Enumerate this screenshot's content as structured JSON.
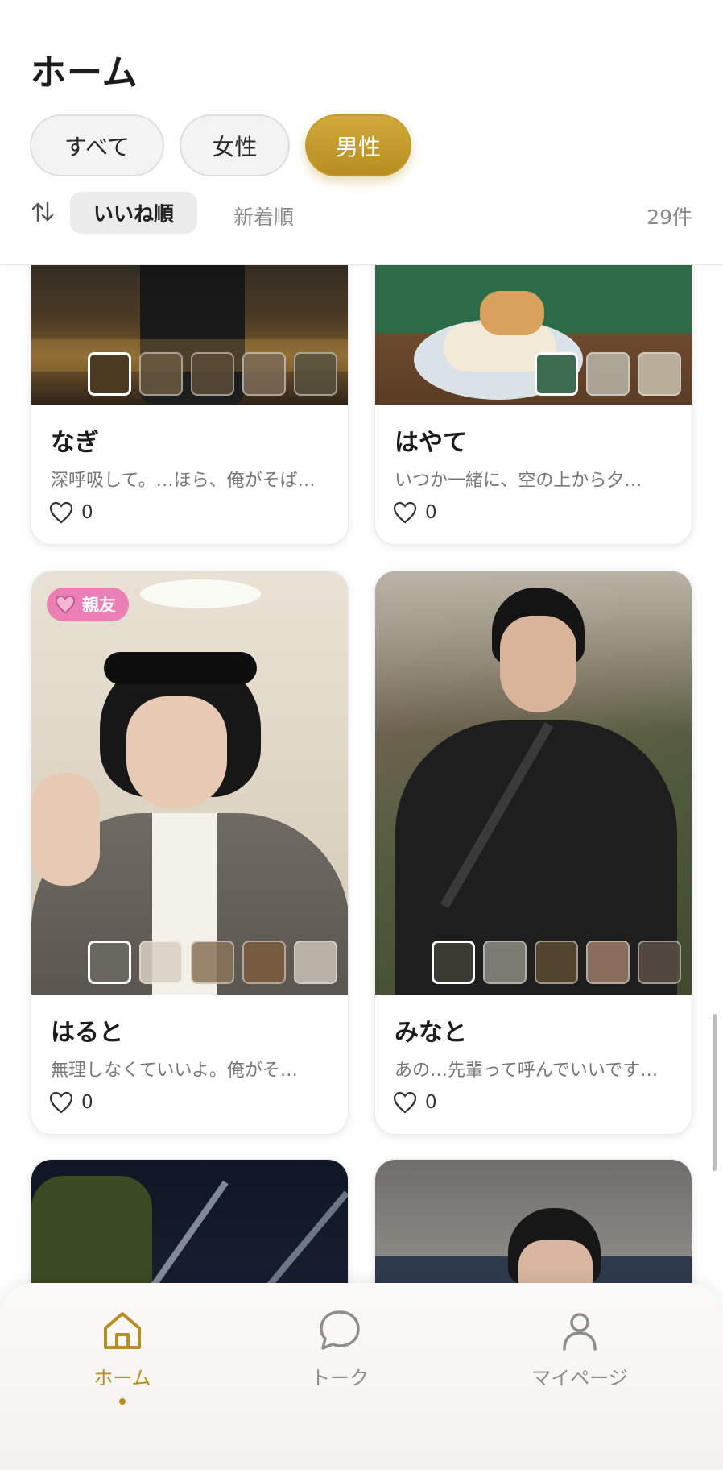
{
  "header": {
    "title": "ホーム",
    "filters": [
      {
        "label": "すべて",
        "active": false
      },
      {
        "label": "女性",
        "active": false
      },
      {
        "label": "男性",
        "active": true
      }
    ],
    "sort": {
      "icon": "sort-arrows-icon",
      "active_label": "いいね順",
      "other_label": "新着順"
    },
    "count": "29件"
  },
  "cards": [
    {
      "name": "なぎ",
      "bio": "深呼吸して。…ほら、俺がそば…",
      "likes": "0",
      "badge": null
    },
    {
      "name": "はやて",
      "bio": "いつか一緒に、空の上から夕…",
      "likes": "0",
      "badge": null
    },
    {
      "name": "はると",
      "bio": "無理しなくていいよ。俺がそ…",
      "likes": "0",
      "badge": {
        "icon": "heart-icon",
        "label": "親友"
      }
    },
    {
      "name": "みなと",
      "bio": "あの…先輩って呼んでいいです…",
      "likes": "0",
      "badge": null
    },
    {
      "name": "",
      "bio": "",
      "likes": "",
      "badge": null
    },
    {
      "name": "",
      "bio": "",
      "likes": "",
      "badge": null
    }
  ],
  "nav": {
    "items": [
      {
        "label": "ホーム",
        "icon": "home-icon",
        "active": true
      },
      {
        "label": "トーク",
        "icon": "chat-bubble-icon",
        "active": false
      },
      {
        "label": "マイページ",
        "icon": "person-icon",
        "active": false
      }
    ]
  },
  "colors": {
    "accent": "#C39A2C",
    "badge": "#E97FB5",
    "text": "#1C1C1C",
    "muted": "#8A8A8A"
  }
}
